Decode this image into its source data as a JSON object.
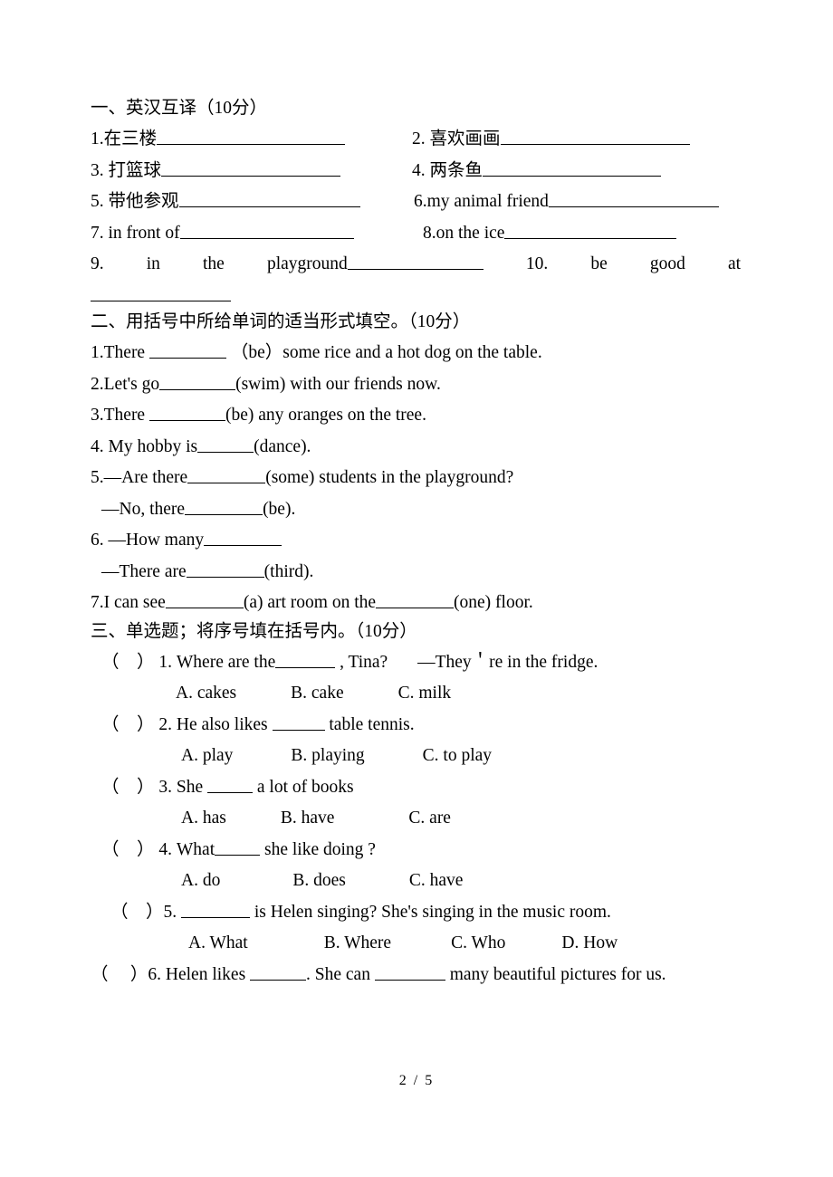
{
  "page": {
    "footer": "2 / 5"
  },
  "sections": [
    {
      "heading": "一、英汉互译（10分）",
      "items": [
        {
          "num": "1.",
          "text": "在三楼"
        },
        {
          "num": "2.",
          "text": "喜欢画画"
        },
        {
          "num": "3.",
          "text": "打篮球"
        },
        {
          "num": "4.",
          "text": "两条鱼"
        },
        {
          "num": "5.",
          "text": "带他参观"
        },
        {
          "num": "6.",
          "text": "my animal friend"
        },
        {
          "num": "7.",
          "text": "in front of"
        },
        {
          "num": "8.",
          "text": "on the ice"
        },
        {
          "num": "9.",
          "text": "in the playground"
        },
        {
          "num": "10.",
          "text": "be good at"
        }
      ],
      "justified": {
        "q9_num": "9.",
        "q9_w1": "in",
        "q9_w2": "the",
        "q9_w3": "playground",
        "q10_num": "10.",
        "q10_w1": "be",
        "q10_w2": "good",
        "q10_w3": "at"
      }
    },
    {
      "heading": "二、用括号中所给单词的适当形式填空。（10分）",
      "questions": [
        {
          "lead": "1.There",
          "mid": "（be）some rice and a hot dog on the table."
        },
        {
          "lead": "2.Let's go",
          "mid": "(swim) with our friends now."
        },
        {
          "lead": "3.There",
          "mid": "(be) any oranges on the tree."
        },
        {
          "lead": "4. My hobby is",
          "mid": "(dance)."
        },
        {
          "lead": "5.—Are there",
          "mid": "(some) students in the playground?"
        },
        {
          "lead": "—No, there",
          "mid": "(be)."
        },
        {
          "lead": "6. —How many",
          "mid": ""
        },
        {
          "lead": "—There are",
          "mid": "(third)."
        },
        {
          "lead": "7.I can see",
          "mid": "(a) art room on the",
          "tail": "(one) floor."
        }
      ]
    },
    {
      "heading": "三、单选题；将序号填在括号内。（10分）",
      "questions": [
        {
          "num": "1.",
          "stem_a": "Where are the",
          "stem_b": ", Tina?",
          "stem_c": "—They＇re in the fridge.",
          "options": [
            "A. cakes",
            "B. cake",
            "C. milk"
          ]
        },
        {
          "num": "2.",
          "stem_a": "He also likes",
          "stem_b": "table tennis.",
          "options": [
            "A. play",
            "B. playing",
            "C. to play"
          ]
        },
        {
          "num": "3.",
          "stem_a": "She",
          "stem_b": "a lot of books",
          "options": [
            "A. has",
            "B. have",
            "C. are"
          ]
        },
        {
          "num": "4.",
          "stem_a": "What",
          "stem_b": "she like doing ?",
          "options": [
            "A. do",
            "B. does",
            "C. have"
          ]
        },
        {
          "num": "5.",
          "stem_a": "",
          "stem_b": "is Helen singing? She's singing in the music room.",
          "options": [
            "A. What",
            "B. Where",
            "C. Who",
            "D. How"
          ]
        },
        {
          "num": "6.",
          "stem_a": "Helen likes",
          "stem_b": ". She can",
          "stem_c": "many beautiful pictures for us.",
          "options": []
        }
      ]
    }
  ]
}
